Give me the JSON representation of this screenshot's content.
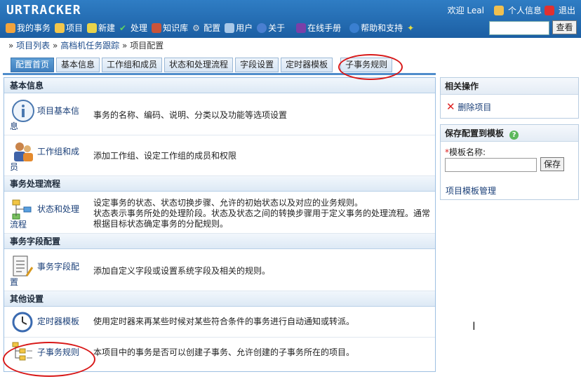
{
  "app": {
    "logo": "URTRACKER"
  },
  "user": {
    "welcome": "欢迎 Leal",
    "profile": "个人信息",
    "logout": "退出"
  },
  "nav": [
    {
      "label": "我的事务",
      "icon": "home-icon"
    },
    {
      "label": "项目",
      "icon": "database-icon"
    },
    {
      "label": "新建",
      "icon": "new-icon"
    },
    {
      "label": "处理",
      "icon": "check-icon"
    },
    {
      "label": "知识库",
      "icon": "books-icon"
    },
    {
      "label": "配置",
      "icon": "gear-icon"
    },
    {
      "label": "用户",
      "icon": "users-icon"
    },
    {
      "label": "关于",
      "icon": "info-icon"
    },
    {
      "label": "在线手册",
      "icon": "manual-icon"
    },
    {
      "label": "帮助和支持",
      "icon": "help-icon"
    }
  ],
  "search": {
    "button": "查看"
  },
  "breadcrumb": {
    "sep": "»",
    "items": [
      "项目列表",
      "高档机任务跟踪",
      "项目配置"
    ]
  },
  "tabs": [
    "配置首页",
    "基本信息",
    "工作组和成员",
    "状态和处理流程",
    "字段设置",
    "定时器模板",
    "子事务规则"
  ],
  "sections": {
    "basic": {
      "title": "基本信息",
      "items": [
        {
          "title_1": "项目基本信",
          "title_2": "息",
          "desc": "事务的名称、编码、说明、分类以及功能等选项设置"
        },
        {
          "title_1": "工作组和成",
          "title_2": "员",
          "desc": "添加工作组、设定工作组的成员和权限"
        }
      ]
    },
    "flow": {
      "title": "事务处理流程",
      "item": {
        "title_1": "状态和处理",
        "title_2": "流程",
        "desc_1": "设定事务的状态、状态切换步骤、允许的初始状态以及对应的业务规则。",
        "desc_2": "状态表示事务所处的处理阶段。状态及状态之间的转换步骤用于定义事务的处理流程。通常",
        "desc_3": "根据目标状态确定事务的分配规则。"
      }
    },
    "fields": {
      "title": "事务字段配置",
      "item": {
        "title_1": "事务字段配",
        "title_2": "置",
        "desc": "添加自定义字段或设置系统字段及相关的规则。"
      }
    },
    "other": {
      "title": "其他设置",
      "items": [
        {
          "title": "定时器模板",
          "desc": "使用定时器来再某些时候对某些符合条件的事务进行自动通知或转派。"
        },
        {
          "title": "子事务规则",
          "desc": "本项目中的事务是否可以创建子事务、允许创建的子事务所在的项目。"
        }
      ]
    }
  },
  "side": {
    "ops": {
      "title": "相关操作",
      "delete": "删除项目"
    },
    "template": {
      "title": "保存配置到模板",
      "required": "*",
      "label": "模板名称:",
      "save": "保存",
      "manage": "项目模板管理"
    }
  },
  "colors": {
    "header": "#2f7dc4",
    "accent": "#d81818",
    "link": "#1a3f78"
  }
}
